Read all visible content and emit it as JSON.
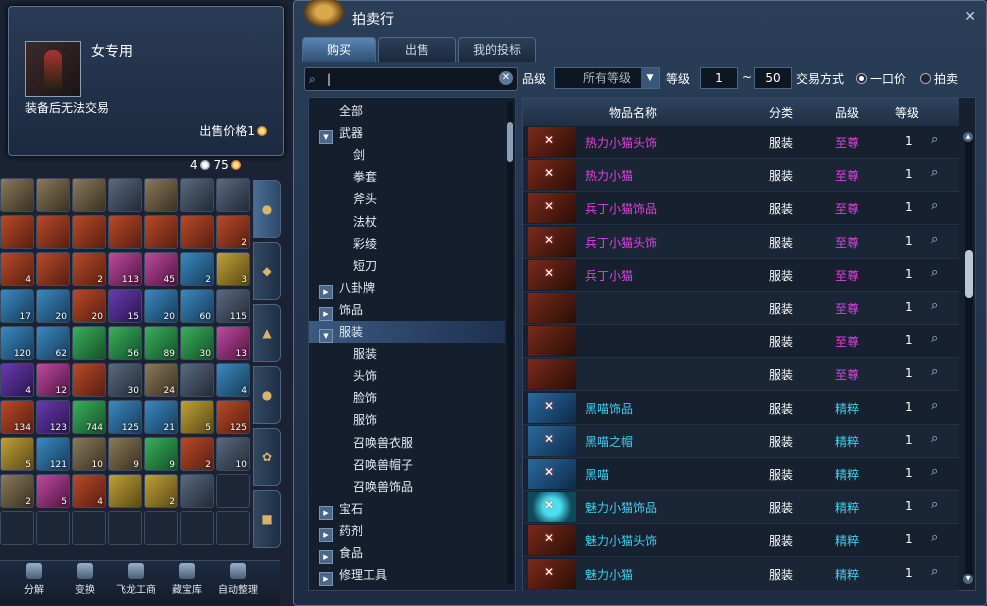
{
  "tooltip": {
    "title": "女专用",
    "trade_note": "装备后无法交易",
    "price_label": "出售价格1"
  },
  "currency": {
    "silver": "4",
    "gold": "75"
  },
  "inventory": {
    "cells": [
      {
        "t": "c1",
        "n": ""
      },
      {
        "t": "c1",
        "n": ""
      },
      {
        "t": "c1",
        "n": ""
      },
      {
        "t": "c8",
        "n": ""
      },
      {
        "t": "c1",
        "n": ""
      },
      {
        "t": "c8",
        "n": ""
      },
      {
        "t": "c8",
        "n": ""
      },
      {
        "t": "c2",
        "n": ""
      },
      {
        "t": "c2",
        "n": ""
      },
      {
        "t": "c2",
        "n": ""
      },
      {
        "t": "c2",
        "n": ""
      },
      {
        "t": "c2",
        "n": ""
      },
      {
        "t": "c2",
        "n": ""
      },
      {
        "t": "c2",
        "n": "2"
      },
      {
        "t": "c2",
        "n": "4"
      },
      {
        "t": "c2",
        "n": ""
      },
      {
        "t": "c2",
        "n": "2"
      },
      {
        "t": "c7",
        "n": "113"
      },
      {
        "t": "c7",
        "n": "45"
      },
      {
        "t": "c4",
        "n": "2"
      },
      {
        "t": "c6",
        "n": "3"
      },
      {
        "t": "c4",
        "n": "17"
      },
      {
        "t": "c4",
        "n": "20"
      },
      {
        "t": "c2",
        "n": "20"
      },
      {
        "t": "c3",
        "n": "15"
      },
      {
        "t": "c4",
        "n": "20"
      },
      {
        "t": "c4",
        "n": "60"
      },
      {
        "t": "c8",
        "n": "115"
      },
      {
        "t": "c4",
        "n": "120"
      },
      {
        "t": "c4",
        "n": "62"
      },
      {
        "t": "c5",
        "n": ""
      },
      {
        "t": "c5",
        "n": "56"
      },
      {
        "t": "c5",
        "n": "89"
      },
      {
        "t": "c5",
        "n": "30"
      },
      {
        "t": "c7",
        "n": "13"
      },
      {
        "t": "c3",
        "n": "4"
      },
      {
        "t": "c7",
        "n": "12"
      },
      {
        "t": "c2",
        "n": ""
      },
      {
        "t": "c8",
        "n": "30"
      },
      {
        "t": "c1",
        "n": "24"
      },
      {
        "t": "c8",
        "n": ""
      },
      {
        "t": "c4",
        "n": "4"
      },
      {
        "t": "c2",
        "n": "134"
      },
      {
        "t": "c3",
        "n": "123"
      },
      {
        "t": "c5",
        "n": "744"
      },
      {
        "t": "c4",
        "n": "125"
      },
      {
        "t": "c4",
        "n": "21"
      },
      {
        "t": "c6",
        "n": "5"
      },
      {
        "t": "c2",
        "n": "125"
      },
      {
        "t": "c6",
        "n": "5"
      },
      {
        "t": "c4",
        "n": "121"
      },
      {
        "t": "c1",
        "n": "10"
      },
      {
        "t": "c1",
        "n": "9"
      },
      {
        "t": "c5",
        "n": "9"
      },
      {
        "t": "c2",
        "n": "2"
      },
      {
        "t": "c8",
        "n": "10"
      },
      {
        "t": "c1",
        "n": "2"
      },
      {
        "t": "c7",
        "n": "5"
      },
      {
        "t": "c2",
        "n": "4"
      },
      {
        "t": "c6",
        "n": ""
      },
      {
        "t": "c6",
        "n": "2"
      },
      {
        "t": "c8",
        "n": ""
      },
      {
        "t": "empty",
        "n": ""
      },
      {
        "t": "empty",
        "n": ""
      },
      {
        "t": "empty",
        "n": ""
      },
      {
        "t": "empty",
        "n": ""
      },
      {
        "t": "empty",
        "n": ""
      },
      {
        "t": "empty",
        "n": ""
      },
      {
        "t": "empty",
        "n": ""
      },
      {
        "t": "empty",
        "n": ""
      }
    ]
  },
  "bottom_bar": [
    "分解",
    "变换",
    "飞龙工商",
    "藏宝库",
    "自动整理"
  ],
  "auction": {
    "title": "拍卖行",
    "tabs": [
      "购买",
      "出售",
      "我的投标"
    ],
    "search": {
      "value": "|",
      "placeholder": ""
    },
    "grade_label": "品级",
    "grade_value": "所有等级",
    "level_label": "等级",
    "level_min": "1",
    "level_sep": "~",
    "level_max": "50",
    "trade_label": "交易方式",
    "trade_options": [
      "一口价",
      "拍卖"
    ],
    "tree": [
      {
        "label": "全部",
        "level": 0,
        "toggle": ""
      },
      {
        "label": "武器",
        "level": 0,
        "toggle": "▼"
      },
      {
        "label": "剑",
        "level": 1,
        "toggle": ""
      },
      {
        "label": "拳套",
        "level": 1,
        "toggle": ""
      },
      {
        "label": "斧头",
        "level": 1,
        "toggle": ""
      },
      {
        "label": "法杖",
        "level": 1,
        "toggle": ""
      },
      {
        "label": "彩绫",
        "level": 1,
        "toggle": ""
      },
      {
        "label": "短刀",
        "level": 1,
        "toggle": ""
      },
      {
        "label": "八卦牌",
        "level": 0,
        "toggle": "▶"
      },
      {
        "label": "饰品",
        "level": 0,
        "toggle": "▶"
      },
      {
        "label": "服装",
        "level": 0,
        "toggle": "▼",
        "selected": true
      },
      {
        "label": "服装",
        "level": 1,
        "toggle": ""
      },
      {
        "label": "头饰",
        "level": 1,
        "toggle": ""
      },
      {
        "label": "脸饰",
        "level": 1,
        "toggle": ""
      },
      {
        "label": "服饰",
        "level": 1,
        "toggle": ""
      },
      {
        "label": "召唤兽衣服",
        "level": 1,
        "toggle": ""
      },
      {
        "label": "召唤兽帽子",
        "level": 1,
        "toggle": ""
      },
      {
        "label": "召唤兽饰品",
        "level": 1,
        "toggle": ""
      },
      {
        "label": "宝石",
        "level": 0,
        "toggle": "▶"
      },
      {
        "label": "药剂",
        "level": 0,
        "toggle": "▶"
      },
      {
        "label": "食品",
        "level": 0,
        "toggle": "▶"
      },
      {
        "label": "修理工具",
        "level": 0,
        "toggle": "▶"
      }
    ],
    "columns": [
      "物品名称",
      "分类",
      "品级",
      "等级"
    ],
    "rows": [
      {
        "name": "热力小猫头饰",
        "cat": "服装",
        "grade": "至尊",
        "lvl": "1",
        "color": "#e040e0",
        "gcolor": "#e040e0",
        "icon": "red"
      },
      {
        "name": "热力小猫",
        "cat": "服装",
        "grade": "至尊",
        "lvl": "1",
        "color": "#e040e0",
        "gcolor": "#e040e0",
        "icon": "red"
      },
      {
        "name": "兵丁小猫饰品",
        "cat": "服装",
        "grade": "至尊",
        "lvl": "1",
        "color": "#e040e0",
        "gcolor": "#e040e0",
        "icon": "red"
      },
      {
        "name": "兵丁小猫头饰",
        "cat": "服装",
        "grade": "至尊",
        "lvl": "1",
        "color": "#e040e0",
        "gcolor": "#e040e0",
        "icon": "red"
      },
      {
        "name": "兵丁小猫",
        "cat": "服装",
        "grade": "至尊",
        "lvl": "1",
        "color": "#e040e0",
        "gcolor": "#e040e0",
        "icon": "red"
      },
      {
        "name": "",
        "cat": "服装",
        "grade": "至尊",
        "lvl": "1",
        "color": "#e040e0",
        "gcolor": "#e040e0",
        "icon": "plain"
      },
      {
        "name": "",
        "cat": "服装",
        "grade": "至尊",
        "lvl": "1",
        "color": "#e040e0",
        "gcolor": "#e040e0",
        "icon": "plain"
      },
      {
        "name": "",
        "cat": "服装",
        "grade": "至尊",
        "lvl": "1",
        "color": "#e040e0",
        "gcolor": "#e040e0",
        "icon": "plain"
      },
      {
        "name": "黑喵饰品",
        "cat": "服装",
        "grade": "精粹",
        "lvl": "1",
        "color": "#40d0f0",
        "gcolor": "#40d0f0",
        "icon": "blue"
      },
      {
        "name": "黑喵之帽",
        "cat": "服装",
        "grade": "精粹",
        "lvl": "1",
        "color": "#40d0f0",
        "gcolor": "#40d0f0",
        "icon": "blue"
      },
      {
        "name": "黑喵",
        "cat": "服装",
        "grade": "精粹",
        "lvl": "1",
        "color": "#40d0f0",
        "gcolor": "#40d0f0",
        "icon": "blue"
      },
      {
        "name": "魅力小猫饰品",
        "cat": "服装",
        "grade": "精粹",
        "lvl": "1",
        "color": "#40d0f0",
        "gcolor": "#40d0f0",
        "icon": "cyan"
      },
      {
        "name": "魅力小猫头饰",
        "cat": "服装",
        "grade": "精粹",
        "lvl": "1",
        "color": "#40d0f0",
        "gcolor": "#40d0f0",
        "icon": "red"
      },
      {
        "name": "魅力小猫",
        "cat": "服装",
        "grade": "精粹",
        "lvl": "1",
        "color": "#40d0f0",
        "gcolor": "#40d0f0",
        "icon": "red"
      }
    ]
  }
}
